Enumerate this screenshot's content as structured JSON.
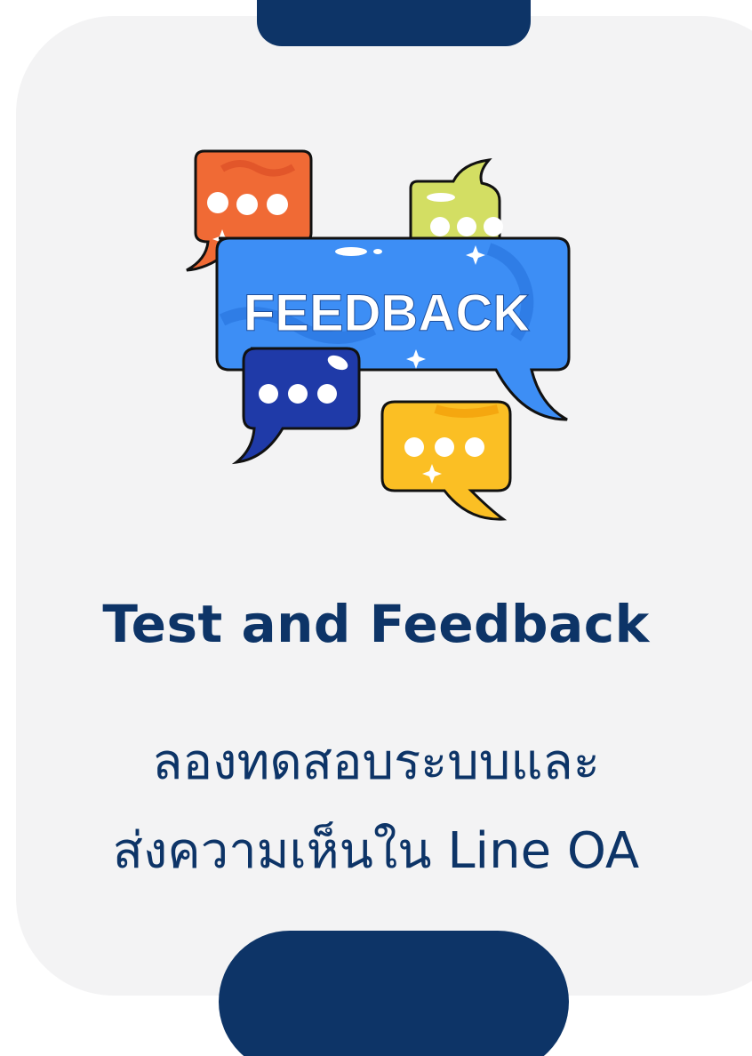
{
  "title": "Test and Feedback",
  "subtitle_line1": "ลองทดสอบระบบและ",
  "subtitle_line2": "ส่งความเห็นใน Line OA",
  "badge_text": "FEEDBACK",
  "colors": {
    "navy": "#0d3467",
    "card_bg": "#f3f3f4",
    "bubble_blue": "#3d8ef5",
    "bubble_orange": "#f06a35",
    "bubble_lime": "#d3de63",
    "bubble_darkblue": "#1f3aa8",
    "bubble_yellow": "#fbbf24"
  },
  "icons": [
    "feedback-speech-bubbles-illustration"
  ]
}
